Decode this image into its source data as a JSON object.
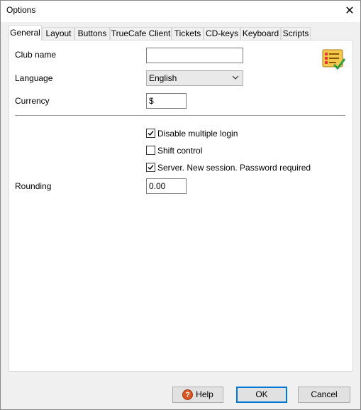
{
  "window": {
    "title": "Options"
  },
  "tabs": [
    {
      "label": "General"
    },
    {
      "label": "Layout"
    },
    {
      "label": "Buttons"
    },
    {
      "label": "TrueCafe Client"
    },
    {
      "label": "Tickets"
    },
    {
      "label": "CD-keys"
    },
    {
      "label": "Keyboard"
    },
    {
      "label": "Scripts"
    }
  ],
  "general": {
    "club_name_label": "Club name",
    "club_name_value": "",
    "language_label": "Language",
    "language_value": "English",
    "currency_label": "Currency",
    "currency_value": "$",
    "rounding_label": "Rounding",
    "rounding_value": "0.00",
    "checkboxes": [
      {
        "label": "Disable multiple login",
        "checked": true
      },
      {
        "label": "Shift control",
        "checked": false
      },
      {
        "label": "Server. New session. Password required",
        "checked": true
      }
    ]
  },
  "footer": {
    "help_label": "Help",
    "ok_label": "OK",
    "cancel_label": "Cancel"
  },
  "icons": {
    "close": "close-icon",
    "help": "help-icon",
    "logo": "checklist-icon",
    "select": "chevron-down-icon",
    "check": "checkmark-icon"
  },
  "colors": {
    "default_button_border": "#0078d7",
    "help_icon": "#d9541e"
  }
}
